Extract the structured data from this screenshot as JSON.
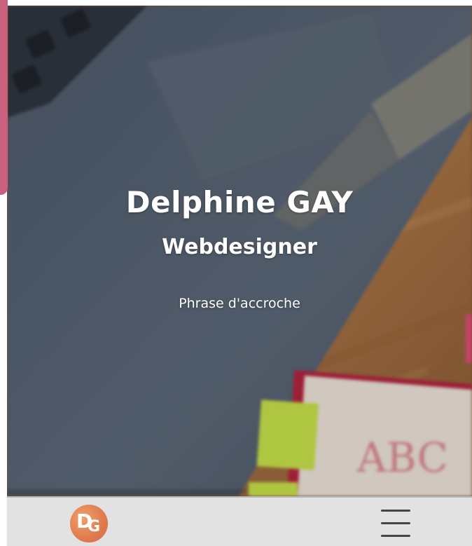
{
  "hero": {
    "name": "Delphine GAY",
    "role": "Webdesigner",
    "tagline": "Phrase d'accroche"
  },
  "bottom_bar": {
    "logo_letters": [
      "D",
      "G"
    ],
    "menu_icon": "hamburger-menu-icon"
  },
  "colors": {
    "accent": "#c9607e",
    "logo": "#e07a4c",
    "bar_background": "#e2e2e2"
  }
}
